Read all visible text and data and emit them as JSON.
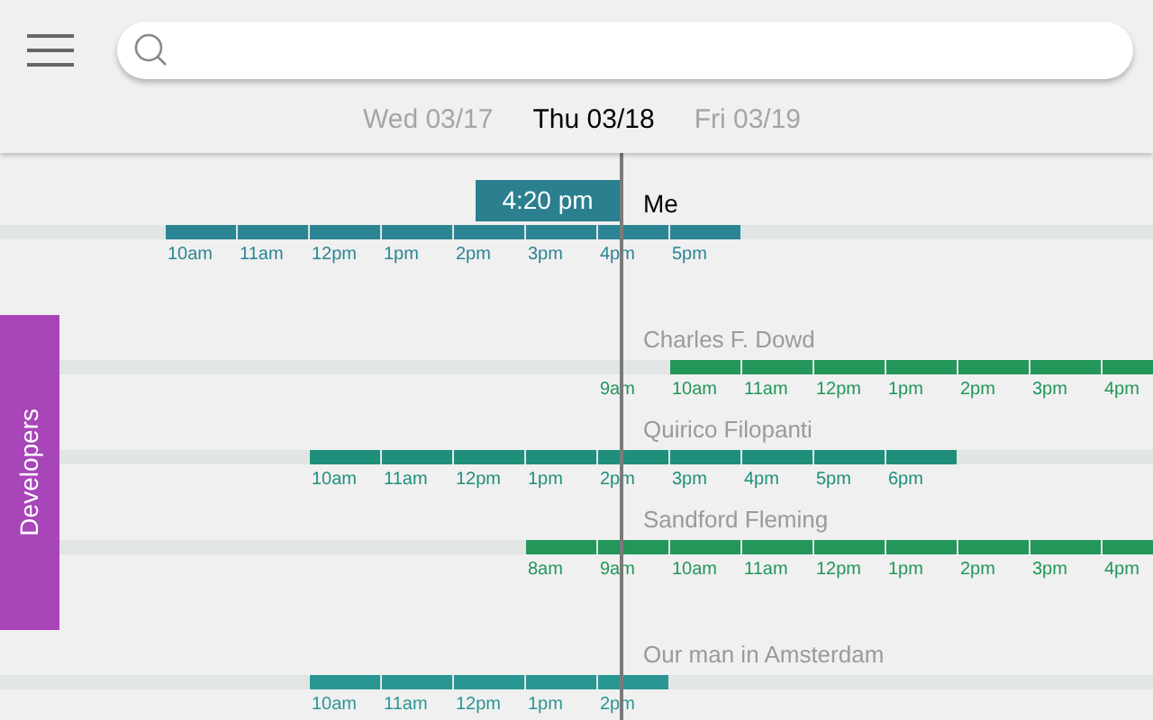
{
  "header": {
    "days": [
      {
        "label": "Wed 03/17",
        "selected": false
      },
      {
        "label": "Thu 03/18",
        "selected": true
      },
      {
        "label": "Fri 03/19",
        "selected": false
      }
    ]
  },
  "now": {
    "label": "4:20 pm"
  },
  "group": {
    "label": "Developers",
    "color": "#a845b8"
  },
  "people": [
    {
      "kind": "self",
      "name": "Me",
      "color": "#2b8594",
      "hours": [
        {
          "label": "10am",
          "working": true
        },
        {
          "label": "11am",
          "working": true
        },
        {
          "label": "12pm",
          "working": true
        },
        {
          "label": "1pm",
          "working": true
        },
        {
          "label": "2pm",
          "working": true
        },
        {
          "label": "3pm",
          "working": true
        },
        {
          "label": "4pm",
          "working": true
        },
        {
          "label": "5pm",
          "working": true
        }
      ]
    },
    {
      "kind": "contact",
      "name": "Charles F. Dowd",
      "color": "#23965a",
      "hours": [
        {
          "label": "9am",
          "working": false
        },
        {
          "label": "10am",
          "working": true
        },
        {
          "label": "11am",
          "working": true
        },
        {
          "label": "12pm",
          "working": true
        },
        {
          "label": "1pm",
          "working": true
        },
        {
          "label": "2pm",
          "working": true
        },
        {
          "label": "3pm",
          "working": true
        },
        {
          "label": "4pm",
          "working": true
        }
      ]
    },
    {
      "kind": "contact",
      "name": "Quirico Filopanti",
      "color": "#1f8f7c",
      "hours": [
        {
          "label": "10am",
          "working": true
        },
        {
          "label": "11am",
          "working": true
        },
        {
          "label": "12pm",
          "working": true
        },
        {
          "label": "1pm",
          "working": true
        },
        {
          "label": "2pm",
          "working": true
        },
        {
          "label": "3pm",
          "working": true
        },
        {
          "label": "4pm",
          "working": true
        },
        {
          "label": "5pm",
          "working": true
        },
        {
          "label": "6pm",
          "working": true
        }
      ]
    },
    {
      "kind": "contact",
      "name": "Sandford Fleming",
      "color": "#23965a",
      "hours": [
        {
          "label": "8am",
          "working": true
        },
        {
          "label": "9am",
          "working": true
        },
        {
          "label": "10am",
          "working": true
        },
        {
          "label": "11am",
          "working": true
        },
        {
          "label": "12pm",
          "working": true
        },
        {
          "label": "1pm",
          "working": true
        },
        {
          "label": "2pm",
          "working": true
        },
        {
          "label": "3pm",
          "working": true
        },
        {
          "label": "4pm",
          "working": true
        }
      ]
    },
    {
      "kind": "contact",
      "name": "Our man in Amsterdam",
      "color": "#2a9693",
      "hours": [
        {
          "label": "10am",
          "working": true
        },
        {
          "label": "11am",
          "working": true
        },
        {
          "label": "12pm",
          "working": true
        },
        {
          "label": "1pm",
          "working": true
        },
        {
          "label": "2pm",
          "working": true
        }
      ]
    }
  ]
}
